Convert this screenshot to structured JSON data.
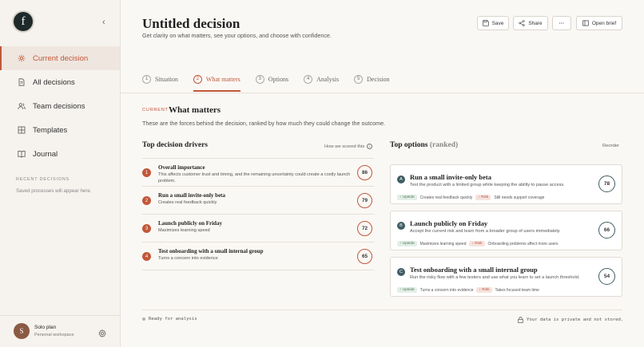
{
  "sidebar": {
    "logo": "f",
    "items": [
      {
        "label": "Current decision",
        "icon": "sparkle-icon"
      },
      {
        "label": "All decisions",
        "icon": "document-icon"
      },
      {
        "label": "Team decisions",
        "icon": "users-icon"
      },
      {
        "label": "Templates",
        "icon": "grid-icon"
      },
      {
        "label": "Journal",
        "icon": "book-icon"
      }
    ],
    "recent_heading": "RECENT DECISIONS",
    "recent_empty": "Saved processes will appear here.",
    "user": {
      "initial": "S",
      "plan": "Solo plan",
      "workspace": "Personal workspace"
    }
  },
  "header": {
    "title": "Untitled decision",
    "subtitle": "Get clarity on what matters, see your options, and choose with confidence.",
    "save_label": "Save",
    "share_label": "Share",
    "more_label": "···",
    "brief_label": "Open brief"
  },
  "steps": [
    {
      "num": "1",
      "label": "Situation"
    },
    {
      "num": "2",
      "label": "What matters"
    },
    {
      "num": "3",
      "label": "Options"
    },
    {
      "num": "4",
      "label": "Analysis"
    },
    {
      "num": "5",
      "label": "Decision"
    }
  ],
  "section": {
    "current_tag": "CURRENT",
    "title": "What matters",
    "description": "These are the forces behind the decision, ranked by how much they could change the outcome."
  },
  "drivers": {
    "heading": "Top decision drivers",
    "how_label": "How we scored this",
    "items": [
      {
        "rank": "1",
        "name": "Overall importance",
        "desc": "This affects customer trust and timing, and the remaining uncertainty could create a costly launch problem.",
        "score": "86"
      },
      {
        "rank": "2",
        "name": "Run a small invite-only beta",
        "desc": "Creates real feedback quickly",
        "score": "79"
      },
      {
        "rank": "3",
        "name": "Launch publicly on Friday",
        "desc": "Maximizes learning speed",
        "score": "72"
      },
      {
        "rank": "4",
        "name": "Test onboarding with a small internal group",
        "desc": "Turns a concern into evidence",
        "score": "65"
      }
    ]
  },
  "options": {
    "heading": "Top options",
    "heading_suffix": "(ranked)",
    "reorder_label": "Reorder",
    "items": [
      {
        "letter": "A",
        "name": "Run a small invite-only beta",
        "desc": "Test the product with a limited group while keeping the ability to pause access.",
        "upside_label": "Upside",
        "upside": "Creates real feedback quickly",
        "risk_label": "Risk",
        "risk": "Still needs support coverage",
        "score": "78"
      },
      {
        "letter": "B",
        "name": "Launch publicly on Friday",
        "desc": "Accept the current risk and learn from a broader group of users immediately.",
        "upside_label": "Upside",
        "upside": "Maximizes learning speed",
        "risk_label": "Risk",
        "risk": "Onboarding problems affect more users",
        "score": "66"
      },
      {
        "letter": "C",
        "name": "Test onboarding with a small internal group",
        "desc": "Run the risky flow with a few testers and use what you learn to set a launch threshold.",
        "upside_label": "Upside",
        "upside": "Turns a concern into evidence",
        "risk_label": "Risk",
        "risk": "Takes focused team time",
        "score": "54"
      }
    ]
  },
  "footer": {
    "status": "Ready for analysis",
    "privacy": "Your data is private and not stored."
  },
  "colors": {
    "accent": "#c2573a",
    "option_accent": "#3f5d64",
    "background": "#faf8f5"
  }
}
